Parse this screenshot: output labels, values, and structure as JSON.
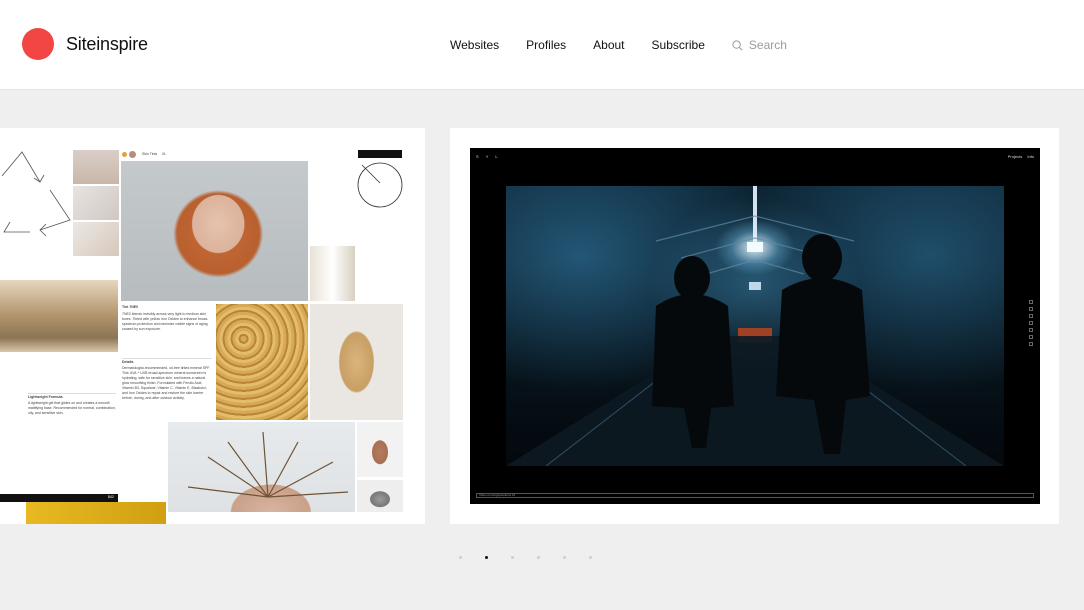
{
  "brand": {
    "name": "Siteinspire",
    "accent": "#f14643"
  },
  "nav": {
    "items": [
      {
        "label": "Websites"
      },
      {
        "label": "Profiles"
      },
      {
        "label": "About"
      },
      {
        "label": "Subscribe"
      }
    ],
    "search_placeholder": "Search"
  },
  "left_card": {
    "badge": "Skin Tints",
    "size_tag": "XL",
    "product_title": "Tint 7NE0",
    "product_desc": "7NE0 blends invisibly across very light to medium skin tones. Tinted with yellow Iron Oxides to enhance broad-spectrum protection and minimize visible signs of aging caused by sun exposure.",
    "details_title": "Details",
    "details_text": "Dermatologist-recommended, oil-free tinted mineral SPF. This UVA + UVB broad-spectrum mineral sunscreen is hydrating, safe for sensitive skin, and leaves a natural glow smoothing finish. Formulated with Ferulic Acid, Vitamin B3, Squalane, Vitamin C, Vitamin E, Bisabolol, and Iron Oxides to repair and restore the skin barrier before, during, and after outdoor activity.",
    "formula_title": "Lightweight Formula",
    "formula_text": "A lightweight gel that glides on and creates a smooth mattifying base. Recommended for normal, combination, oily, and sensitive skin.",
    "bottom_tag": "$42"
  },
  "right_card": {
    "screen_logo": "S Y L",
    "screen_nav": [
      "Projects",
      "Info"
    ],
    "screen_caption": "Video running/questions 01"
  },
  "pager": {
    "count": 6,
    "active_index": 1
  }
}
